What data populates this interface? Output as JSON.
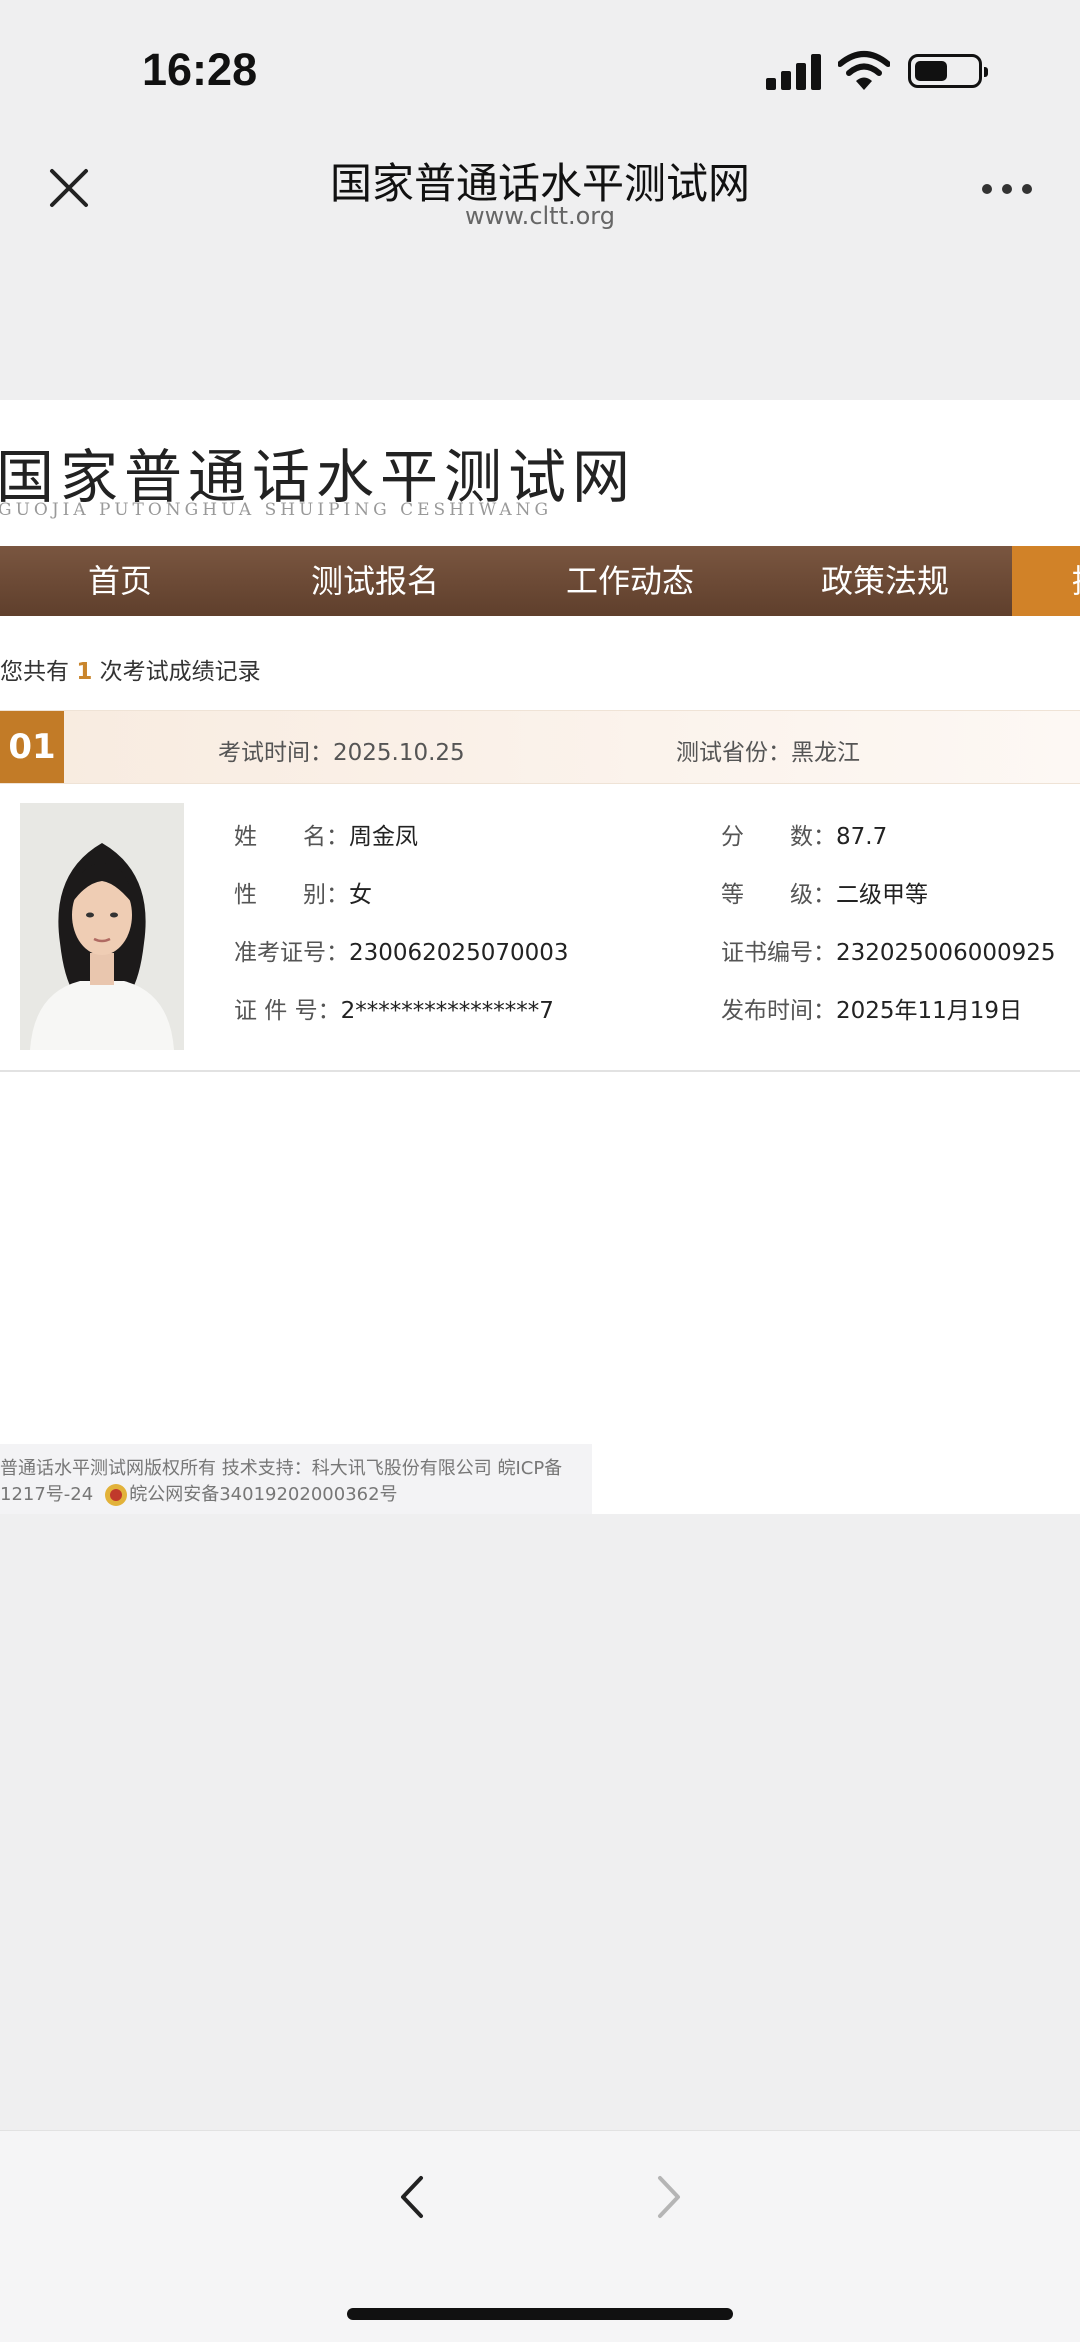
{
  "status_bar": {
    "time": "16:28"
  },
  "webview": {
    "title": "国家普通话水平测试网",
    "url": "www.cltt.org"
  },
  "site": {
    "logo_cn": "国家普通话水平测试网",
    "logo_pinyin": "GUOJIA PUTONGHUA SHUIPING CESHIWANG",
    "nav": [
      "首页",
      "测试报名",
      "工作动态",
      "政策法规"
    ],
    "nav_partial": "授"
  },
  "summary": {
    "prefix": "您共有",
    "count": "1",
    "suffix": "次考试成绩记录"
  },
  "record": {
    "number": "01",
    "exam_time_label": "考试时间：",
    "exam_time": "2025.10.25",
    "province_label": "测试省份：",
    "province": "黑龙江",
    "fields": {
      "name_label": "姓　　名：",
      "name": "周金凤",
      "gender_label": "性　　别：",
      "gender": "女",
      "ticket_label": "准考证号：",
      "ticket": "230062025070003",
      "id_label": "证 件 号：",
      "id": "2****************7",
      "score_label": "分　　数：",
      "score": "87.7",
      "level_label": "等　　级：",
      "level": "二级甲等",
      "cert_label": "证书编号：",
      "cert": "232025006000925",
      "release_label": "发布时间：",
      "release": "2025年11月19日"
    }
  },
  "footer": {
    "line1": "普通话水平测试网版权所有 技术支持：科大讯飞股份有限公司  皖ICP备",
    "line2a": "1217号-24",
    "line2b": "皖公网安备34019202000362号"
  },
  "colors": {
    "nav_bg": "#6b4a35",
    "accent": "#c27b27",
    "header_bg": "#efeff0"
  },
  "icons": {
    "close": "close-icon",
    "more": "more-icon",
    "back": "chevron-left-icon",
    "forward": "chevron-right-icon",
    "police": "police-emblem-icon"
  }
}
